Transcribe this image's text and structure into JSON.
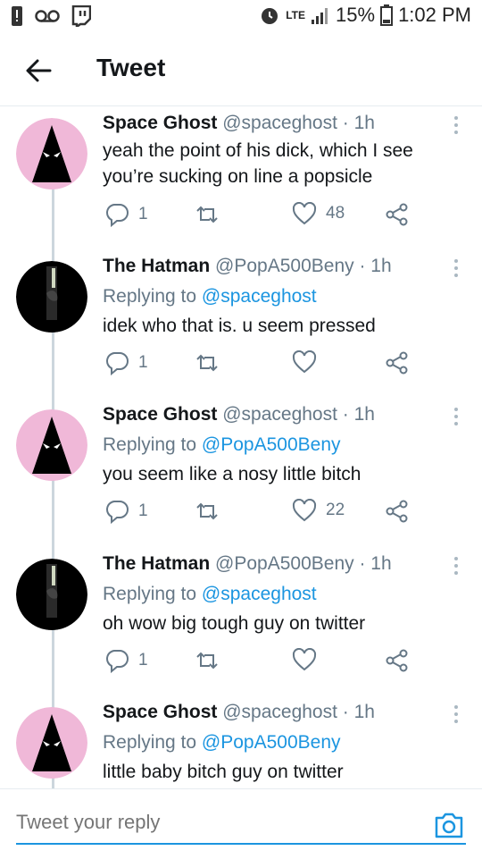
{
  "status": {
    "battery": "15%",
    "time": "1:02 PM",
    "network": "LTE"
  },
  "appbar": {
    "title": "Tweet"
  },
  "tweets": [
    {
      "name": "Space Ghost",
      "handle": "@spaceghost · 1h",
      "replying_label": "",
      "replying_to": "",
      "lines": [
        "yeah the point of his dick, which I see",
        "you’re sucking on line a popsicle"
      ],
      "replies": "1",
      "retweets": "",
      "likes": "48",
      "avatar": "space-ghost"
    },
    {
      "name": "The Hatman",
      "handle": "@PopA500Beny · 1h",
      "replying_label": "Replying to ",
      "replying_to": "@spaceghost",
      "lines": [
        "idek who that is. u seem pressed"
      ],
      "replies": "1",
      "retweets": "",
      "likes": "",
      "avatar": "hatman"
    },
    {
      "name": "Space Ghost",
      "handle": "@spaceghost · 1h",
      "replying_label": "Replying to ",
      "replying_to": "@PopA500Beny",
      "lines": [
        "you seem like a nosy little bitch"
      ],
      "replies": "1",
      "retweets": "",
      "likes": "22",
      "avatar": "space-ghost"
    },
    {
      "name": "The Hatman",
      "handle": "@PopA500Beny · 1h",
      "replying_label": "Replying to ",
      "replying_to": "@spaceghost",
      "lines": [
        "oh wow big tough guy on twitter"
      ],
      "replies": "1",
      "retweets": "",
      "likes": "",
      "avatar": "hatman"
    },
    {
      "name": "Space Ghost",
      "handle": "@spaceghost · 1h",
      "replying_label": "Replying to ",
      "replying_to": "@PopA500Beny",
      "lines": [
        "little baby bitch guy on twitter"
      ],
      "replies": "",
      "retweets": "",
      "likes": "",
      "avatar": "space-ghost"
    }
  ],
  "compose": {
    "placeholder": "Tweet your reply"
  },
  "colors": {
    "accent": "#1b95e0",
    "secondary": "#657786",
    "avatar_pink": "#f0b8d8"
  }
}
